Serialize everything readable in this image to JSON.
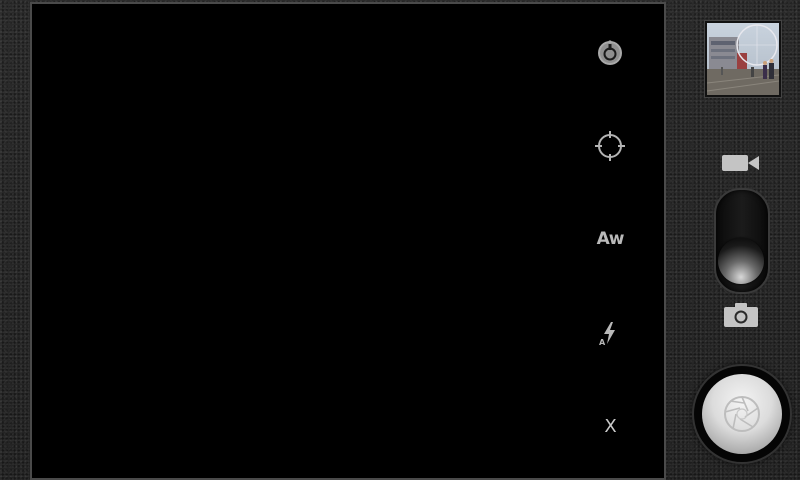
{
  "viewfinder": {
    "background": "#000000"
  },
  "side_controls": [
    {
      "name": "settings-icon",
      "kind": "icon"
    },
    {
      "name": "focus-icon",
      "kind": "icon"
    },
    {
      "name": "white-balance-auto",
      "kind": "text",
      "label": "Aw"
    },
    {
      "name": "flash-auto-icon",
      "kind": "icon"
    },
    {
      "name": "close",
      "kind": "text",
      "label": "X"
    }
  ],
  "gallery": {
    "thumbnail": "street-scene"
  },
  "mode": {
    "selected": "photo",
    "options": [
      "video",
      "photo"
    ]
  },
  "shutter": {
    "icon": "aperture-icon"
  },
  "colors": {
    "frame": "#4a4a4a",
    "icon": "#b9b9b9",
    "background": "#2a2a2a"
  }
}
